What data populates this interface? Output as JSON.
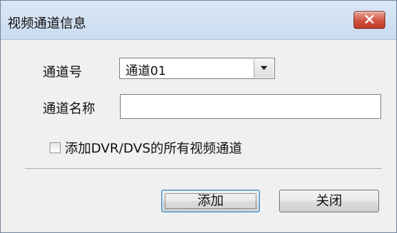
{
  "window": {
    "title": "视频通道信息",
    "close_icon": "close-icon"
  },
  "form": {
    "channel_number_label": "通道号",
    "channel_number_value": "通道01",
    "channel_name_label": "通道名称",
    "channel_name_value": "",
    "add_all_label": "添加DVR/DVS的所有视频通道",
    "add_all_checked": false
  },
  "buttons": {
    "add_label": "添加",
    "close_label": "关闭"
  },
  "colors": {
    "close_button": "#d2533f",
    "titlebar": "#c9dbef"
  }
}
